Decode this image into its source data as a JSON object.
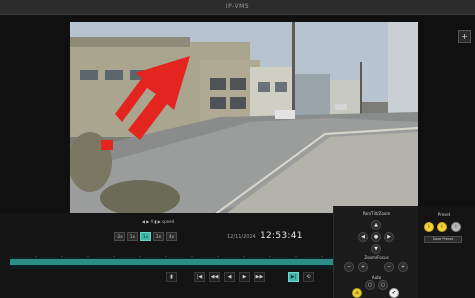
{
  "titlebar": {
    "title": "IP-VMS"
  },
  "video": {
    "alt": "camera view",
    "arrow_color": "#e4241f",
    "marker_color": "#e4241f"
  },
  "side_controls": {
    "expand_icon": "+"
  },
  "speed": {
    "title": "◀ ▶ II ▮ ▶ speed",
    "buttons": [
      "-2x",
      "1x",
      "1x",
      "2x",
      "4x"
    ],
    "active_index": 2
  },
  "time": {
    "label": "12/11/2024",
    "value": "12:53:41"
  },
  "playback": {
    "buttons": [
      "▮",
      "|◀",
      "◀◀",
      "◀",
      "▶",
      "▶▶",
      "▶|",
      "⟲"
    ],
    "active_index": 6
  },
  "ptz": {
    "title_top": "Pan/Tilt/Zoom",
    "title_mid": "Zoom/Focus",
    "title_bottom": "Auto",
    "center_icon": "●"
  },
  "right_panel": {
    "label": "Preset",
    "buttons": [
      "i",
      "i",
      "i"
    ],
    "pill": "Save Preset"
  },
  "status_icons": {
    "pin_icon": "pin",
    "check_icon": "✔"
  },
  "colors": {
    "accent": "#43b8ac",
    "yellow": "#f2d43a",
    "timeline_fill": "#2c8e89"
  }
}
